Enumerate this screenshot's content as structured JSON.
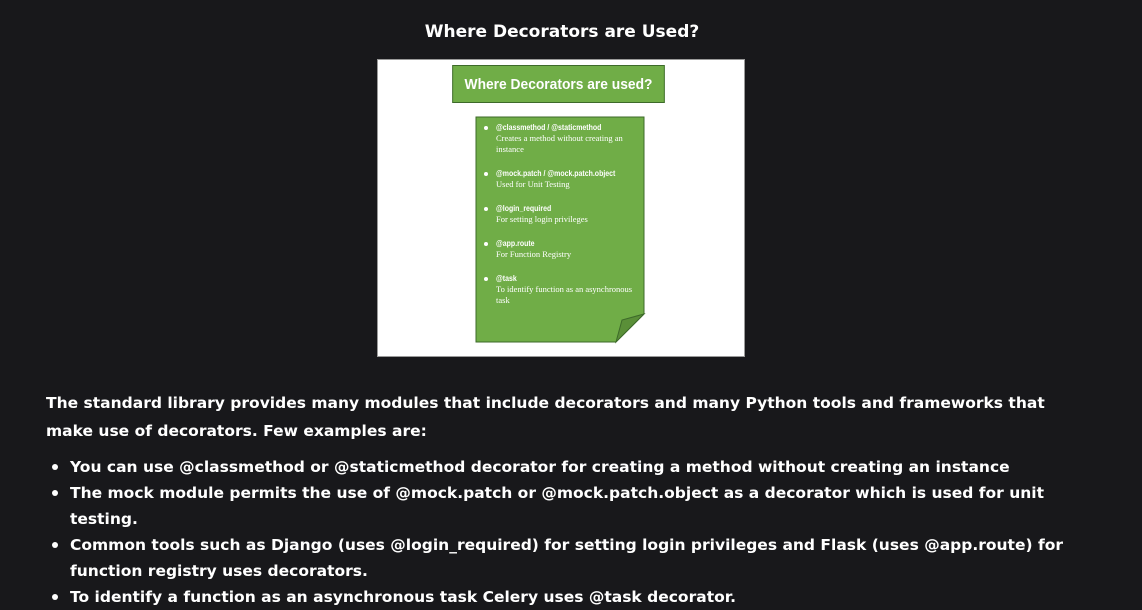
{
  "page": {
    "title": "Where Decorators are Used?"
  },
  "figure": {
    "header": "Where Decorators are used?",
    "colors": {
      "note_fill": "#70ad47",
      "note_border": "#3d6a2a",
      "fold_fill": "#5a8f38"
    },
    "items": [
      {
        "name": "@classmethod / @staticmethod",
        "desc": "Creates a method without creating an instance"
      },
      {
        "name": "@mock.patch / @mock.patch.object",
        "desc": "Used for Unit Testing"
      },
      {
        "name": "@login_required",
        "desc": "For setting login privileges"
      },
      {
        "name": "@app.route",
        "desc": "For Function Registry"
      },
      {
        "name": "@task",
        "desc": "To identify function as an asynchronous task"
      }
    ]
  },
  "content": {
    "intro": "The standard library provides many modules that include decorators and many Python tools and frameworks that make use of decorators. Few examples are:",
    "bullets": [
      "You can use @classmethod or @staticmethod decorator for creating a method without creating an instance",
      "The mock module permits the use of @mock.patch or @mock.patch.object as a decorator which is used for unit testing.",
      "Common tools such as Django (uses @login_required) for setting login privileges and Flask (uses @app.route) for function registry uses decorators.",
      "To identify a function as an asynchronous task Celery uses @task decorator."
    ]
  },
  "theme": {
    "background": "#18181b",
    "text": "#ffffff"
  }
}
